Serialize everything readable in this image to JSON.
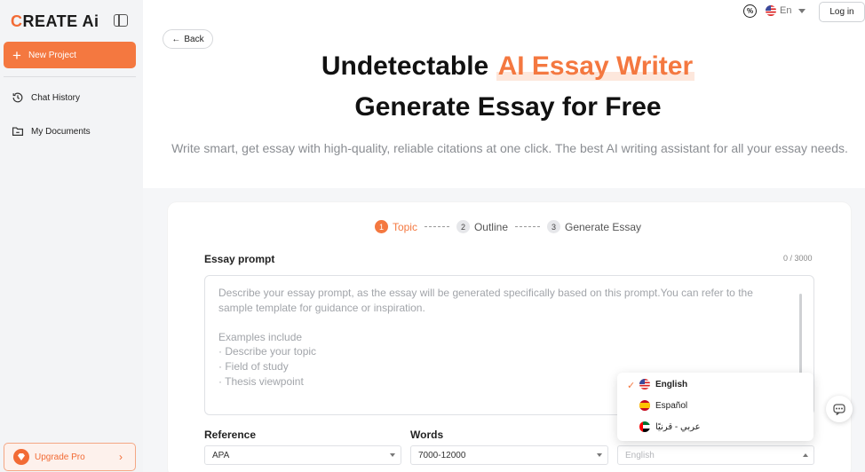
{
  "sidebar": {
    "logo": "REATE Ai",
    "logo_mark": "C",
    "new_project": "New Project",
    "items": [
      {
        "label": "Chat History",
        "icon": "history-icon"
      },
      {
        "label": "My Documents",
        "icon": "folder-icon"
      }
    ],
    "upgrade": "Upgrade Pro"
  },
  "header": {
    "language": "En",
    "login": "Log in"
  },
  "main": {
    "back": "Back",
    "title_prefix": "Undetectable ",
    "title_highlight": "AI Essay Writer",
    "title_line2": "Generate Essay for Free",
    "subtitle": "Write smart, get essay with high-quality, reliable citations at one click. The best AI writing assistant for all your essay needs.",
    "steps": [
      {
        "num": "1",
        "label": "Topic"
      },
      {
        "num": "2",
        "label": "Outline"
      },
      {
        "num": "3",
        "label": "Generate Essay"
      }
    ],
    "prompt_label": "Essay prompt",
    "counter": "0 / 3000",
    "placeholder_lines": [
      "Describe your essay prompt, as the essay will be generated specifically based on this prompt.You can refer to the",
      "sample template for guidance or inspiration.",
      "",
      "Examples include",
      "· Describe your topic",
      "· Field of study",
      "· Thesis viewpoint"
    ],
    "reference_label": "Reference",
    "reference_value": "APA",
    "words_label": "Words",
    "words_value": "7000-12000",
    "language_value": "English"
  },
  "dropdown": {
    "options": [
      "English",
      "Español",
      "عربي - قرنيًا"
    ],
    "selected": "English"
  },
  "colors": {
    "accent": "#f47840",
    "sidebar_bg": "#f3f4f6"
  }
}
